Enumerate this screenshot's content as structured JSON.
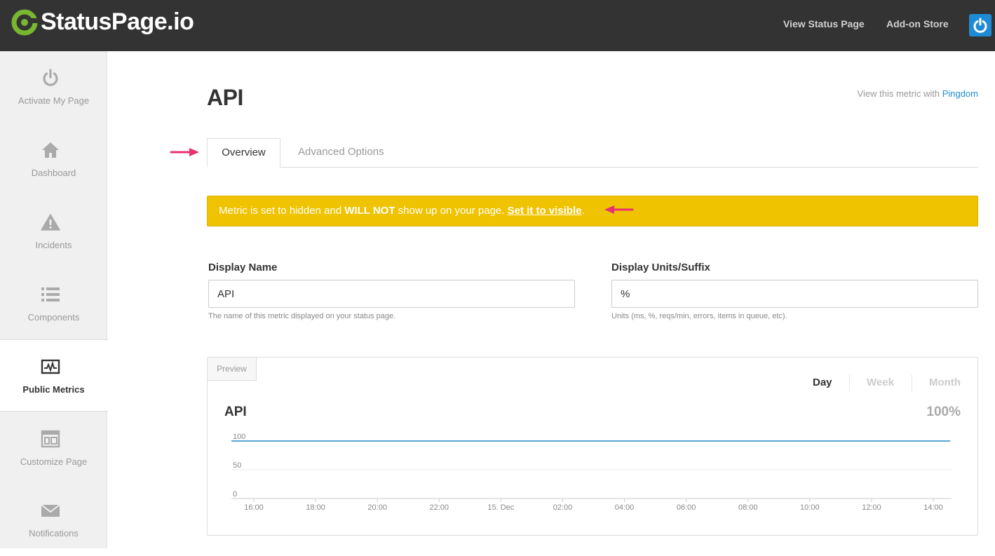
{
  "header": {
    "brand": "StatusPage.io",
    "nav": {
      "view_status_page": "View Status Page",
      "addon_store": "Add-on Store"
    }
  },
  "sidebar": {
    "items": [
      {
        "label": "Activate My Page",
        "icon": "power-icon"
      },
      {
        "label": "Dashboard",
        "icon": "home-icon"
      },
      {
        "label": "Incidents",
        "icon": "warning-icon"
      },
      {
        "label": "Components",
        "icon": "list-icon"
      },
      {
        "label": "Public Metrics",
        "icon": "metrics-icon",
        "active": true
      },
      {
        "label": "Customize Page",
        "icon": "layout-icon"
      },
      {
        "label": "Notifications",
        "icon": "envelope-icon"
      }
    ]
  },
  "main": {
    "title": "API",
    "pingdom_prefix": "View this metric with",
    "pingdom_link": "Pingdom",
    "tabs": {
      "overview": "Overview",
      "advanced": "Advanced Options"
    },
    "alert": {
      "text_1": "Metric is set to hidden and",
      "bold": "WILL NOT",
      "text_2": "show up on your page.",
      "link": "Set it to visible",
      "end": "."
    },
    "display_name": {
      "label": "Display Name",
      "value": "API",
      "help": "The name of this metric displayed on your status page."
    },
    "display_units": {
      "label": "Display Units/Suffix",
      "value": "%",
      "help": "Units (ms, %, reqs/min, errors, items in queue, etc)."
    }
  },
  "preview": {
    "tag": "Preview",
    "ranges": {
      "day": "Day",
      "week": "Week",
      "month": "Month"
    },
    "metric_name": "API",
    "metric_value": "100%"
  },
  "colors": {
    "topbar": "#333333",
    "brand_green": "#7ab730",
    "link_blue": "#1e8bd6",
    "alert_yellow": "#f0c300",
    "annotation_arrow": "#e8316f",
    "series_line": "#1f87c9"
  },
  "chart_data": {
    "type": "line",
    "x": [
      "16:00",
      "18:00",
      "20:00",
      "22:00",
      "15. Dec",
      "02:00",
      "04:00",
      "06:00",
      "08:00",
      "10:00",
      "12:00",
      "14:00"
    ],
    "series": [
      {
        "values": [
          100,
          100,
          100,
          100,
          100,
          100,
          100,
          100,
          100,
          100,
          100,
          100
        ]
      }
    ],
    "yticks": [
      0,
      50,
      100
    ],
    "ylim": [
      0,
      100
    ],
    "grid": true
  }
}
